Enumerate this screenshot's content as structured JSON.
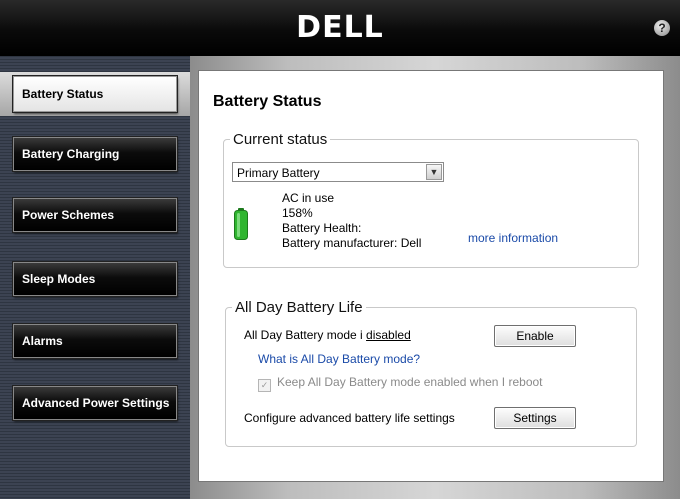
{
  "header": {
    "logo": "DELL",
    "help": "?"
  },
  "nav": {
    "items": [
      {
        "label": "Battery Status",
        "active": true
      },
      {
        "label": "Battery Charging"
      },
      {
        "label": "Power Schemes"
      },
      {
        "label": "Sleep Modes"
      },
      {
        "label": "Alarms"
      },
      {
        "label": "Advanced Power Settings"
      }
    ]
  },
  "main": {
    "title": "Battery Status",
    "current_status": {
      "legend": "Current status",
      "battery_select": "Primary Battery",
      "ac_status": "AC in use",
      "charge_percent": "158%",
      "health_label": "Battery Health:",
      "manufacturer": "Battery manufacturer:  Dell",
      "more_info": "more information"
    },
    "all_day": {
      "legend": "All Day Battery Life",
      "mode_text": "All Day Battery mode i ",
      "mode_state": "disabled",
      "enable_label": "Enable",
      "what_is": "What is All Day Battery mode?",
      "keep_label": "Keep All Day Battery mode enabled when I reboot",
      "configure_text": "Configure advanced battery life settings",
      "settings_label": "Settings"
    }
  },
  "colors": {
    "accent_link": "#1a4aa8",
    "battery_green": "#2fb52f"
  }
}
